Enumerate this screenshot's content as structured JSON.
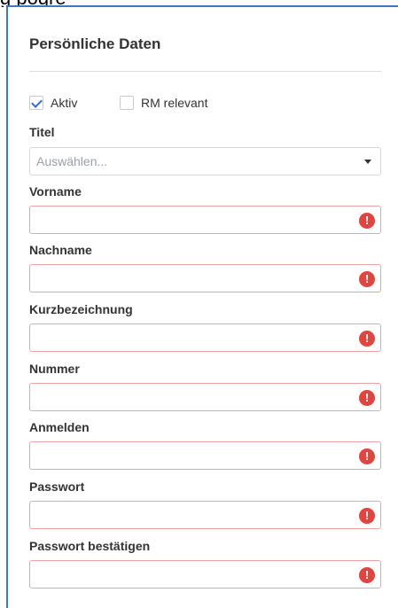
{
  "header": {
    "caption": "g pogre"
  },
  "section": {
    "title": "Persönliche Daten"
  },
  "checkboxes": [
    {
      "label": "Aktiv",
      "checked": true
    },
    {
      "label": "RM relevant",
      "checked": false
    }
  ],
  "fields": {
    "titel": {
      "label": "Titel",
      "placeholder": "Auswählen..."
    },
    "vorname": {
      "label": "Vorname",
      "value": ""
    },
    "nachname": {
      "label": "Nachname",
      "value": ""
    },
    "kurzbezeichnung": {
      "label": "Kurzbezeichnung",
      "value": ""
    },
    "nummer": {
      "label": "Nummer",
      "value": ""
    },
    "anmelden": {
      "label": "Anmelden",
      "value": ""
    },
    "passwort": {
      "label": "Passwort",
      "value": ""
    },
    "passwort_bestaetigen": {
      "label": "Passwort bestätigen",
      "value": ""
    }
  },
  "icons": {
    "error": "exclamation-circle-icon",
    "caret": "chevron-down-icon"
  },
  "colors": {
    "panel_border": "#3a78c3",
    "error_red": "#e0463f",
    "invalid_border": "#f0a3a3",
    "check_blue": "#2f6fd1"
  }
}
